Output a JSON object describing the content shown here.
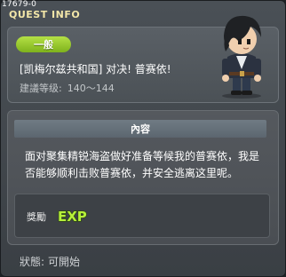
{
  "window": {
    "id": "17679-0",
    "title": "QUEST INFO"
  },
  "quest": {
    "category": "一般",
    "name": "[凯梅尔兹共和国] 对决! 普赛依!",
    "level_label": "建議等级:",
    "level_value": "140～144",
    "portrait_icon": "npc-character-portrait"
  },
  "content": {
    "header": "內容",
    "text": "面对聚集精锐海盗做好准备等候我的普赛依，我是否能够顺利击败普赛依，并安全逃离这里呢。"
  },
  "reward": {
    "label": "獎勵",
    "exp_text": "EXP",
    "exp_icon": "exp-icon"
  },
  "status": {
    "label": "狀態:",
    "value": "可開始"
  },
  "colors": {
    "title": "#f2e6a8",
    "badge": "#9acb2e",
    "exp": "#b6f03a"
  }
}
